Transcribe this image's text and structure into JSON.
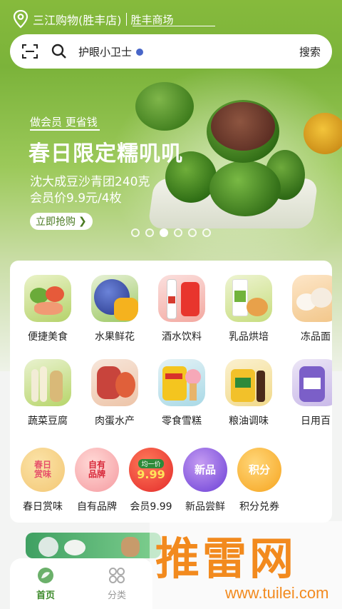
{
  "location": {
    "store": "三江购物(胜丰店)",
    "branch": "胜丰商场"
  },
  "search": {
    "placeholder": "护眼小卫士",
    "button": "搜索"
  },
  "banner": {
    "tag": "做会员 更省钱",
    "title": "春日限定糯叽叽",
    "line1": "沈大成豆沙青团240克",
    "line2": "会员价9.9元/4枚",
    "cta": "立即抢购",
    "dots_total": 6,
    "dots_active_index": 2
  },
  "categories": {
    "row1": [
      "便捷美食",
      "水果鲜花",
      "酒水饮料",
      "乳品烘培",
      "冻品面"
    ],
    "row2": [
      "蔬菜豆腐",
      "肉蛋水产",
      "零食雪糕",
      "粮油调味",
      "日用百"
    ],
    "row3": [
      {
        "label": "春日赏味",
        "badge": "春日\n赏味"
      },
      {
        "label": "自有品牌",
        "badge": "自有\n品牌"
      },
      {
        "label": "会员9.99",
        "badge": "9.99",
        "top": "均一价"
      },
      {
        "label": "新品尝鲜",
        "badge": "新品"
      },
      {
        "label": "积分兑券",
        "badge": "积分"
      }
    ]
  },
  "tabbar": {
    "home": "首页",
    "category": "分类"
  },
  "watermark": {
    "text": "推雷网",
    "url": "www.tuilei.com"
  },
  "colors": {
    "brand_green": "#3c8a2a",
    "watermark_orange": "#f28a1e"
  }
}
